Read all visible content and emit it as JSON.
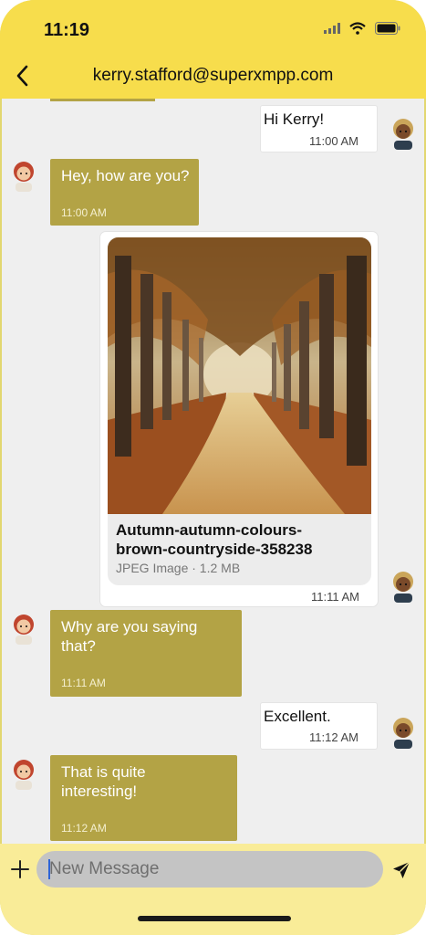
{
  "status_bar": {
    "time": "11:19"
  },
  "header": {
    "title": "kerry.stafford@superxmpp.com"
  },
  "messages": [
    {
      "direction": "outgoing",
      "text": "Hi Kerry!",
      "time": "11:00 AM"
    },
    {
      "direction": "incoming",
      "text": "Hey, how are you?",
      "time": "11:00 AM"
    },
    {
      "direction": "outgoing",
      "type": "image",
      "file_name": "Autumn-autumn-colours-brown-countryside-358238",
      "file_meta": "JPEG Image · 1.2 MB",
      "time": "11:11 AM"
    },
    {
      "direction": "incoming",
      "text": "Why are you saying that?",
      "time": "11:11 AM"
    },
    {
      "direction": "outgoing",
      "text": "Excellent.",
      "time": "11:12 AM"
    },
    {
      "direction": "incoming",
      "text": "That is quite interesting!",
      "time": "11:12 AM"
    }
  ],
  "composer": {
    "placeholder": "New Message"
  },
  "colors": {
    "header": "#f7dd4c",
    "incoming_bubble": "#b3a345",
    "composer": "#f9ec98",
    "background": "#efefef"
  },
  "icons": [
    "back-icon",
    "plus-icon",
    "send-icon",
    "wifi-icon",
    "signal-icon",
    "battery-icon",
    "avatar-icon"
  ]
}
